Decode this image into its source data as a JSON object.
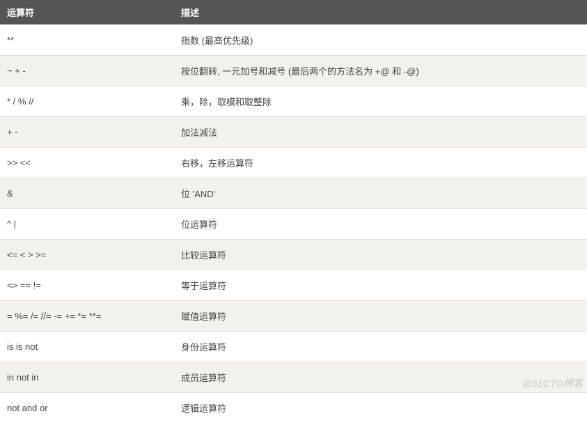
{
  "table": {
    "headers": {
      "operator": "运算符",
      "description": "描述"
    },
    "rows": [
      {
        "operator": "**",
        "description": "指数 (最高优先级)"
      },
      {
        "operator": "~ + -",
        "description": "按位翻转, 一元加号和减号 (最后两个的方法名为 +@ 和 -@)"
      },
      {
        "operator": "* / % //",
        "description": "乘，除，取模和取整除"
      },
      {
        "operator": "+ -",
        "description": "加法减法"
      },
      {
        "operator": ">> <<",
        "description": "右移，左移运算符"
      },
      {
        "operator": "&",
        "description": "位 'AND'"
      },
      {
        "operator": "^ |",
        "description": "位运算符"
      },
      {
        "operator": "<= < > >=",
        "description": "比较运算符"
      },
      {
        "operator": "<> == !=",
        "description": "等于运算符"
      },
      {
        "operator": "= %= /= //= -= += *= **=",
        "description": "赋值运算符"
      },
      {
        "operator": "is is not",
        "description": "身份运算符"
      },
      {
        "operator": "in not in",
        "description": "成员运算符"
      },
      {
        "operator": "not and or",
        "description": "逻辑运算符"
      }
    ]
  },
  "watermark": "@51CTO博客"
}
